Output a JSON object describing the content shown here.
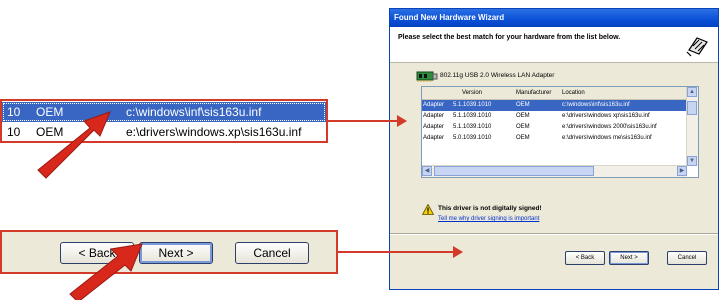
{
  "zoom_list": {
    "rows": [
      {
        "num": "10",
        "mfr": "OEM",
        "path": "c:\\windows\\inf\\sis163u.inf",
        "selected": true
      },
      {
        "num": "10",
        "mfr": "OEM",
        "path": "e:\\drivers\\windows.xp\\sis163u.inf",
        "selected": false
      }
    ]
  },
  "zoom_buttons": {
    "back": "< Back",
    "next": "Next >",
    "cancel": "Cancel"
  },
  "wizard": {
    "title": "Found New Hardware Wizard",
    "header_text": "Please select the best match for your hardware from the list below.",
    "device_name": "802.11g USB 2.0 Wireless LAN Adapter",
    "columns": [
      "Version",
      "Manufacturer",
      "Location"
    ],
    "rows": [
      {
        "name": "Adapter",
        "version": "5.1.1039.1010",
        "manufacturer": "OEM",
        "location": "c:\\windows\\inf\\sis163u.inf",
        "selected": true
      },
      {
        "name": "Adapter",
        "version": "5.1.1039.1010",
        "manufacturer": "OEM",
        "location": "e:\\drivers\\windows xp\\sis163u.inf",
        "selected": false
      },
      {
        "name": "Adapter",
        "version": "5.1.1039.1010",
        "manufacturer": "OEM",
        "location": "e:\\drivers\\windows 2000\\sis163u.inf",
        "selected": false
      },
      {
        "name": "Adapter",
        "version": "5.0.1039.1010",
        "manufacturer": "OEM",
        "location": "e:\\drivers\\windows me\\sis163u.inf",
        "selected": false
      }
    ],
    "warning": "This driver is not digitally signed!",
    "warning_link": "Tell me why driver signing is important",
    "buttons": {
      "back": "< Back",
      "next": "Next >",
      "cancel": "Cancel"
    }
  },
  "colors": {
    "annotation": "#d43a2a",
    "selection": "#3866c2",
    "titlebar": "#0a4fd6"
  },
  "icons": [
    "hardware-wizard-icon",
    "network-card-icon",
    "warning-icon",
    "scroll-up-icon",
    "scroll-down-icon",
    "scroll-left-icon",
    "scroll-right-icon",
    "red-arrow-icon"
  ]
}
